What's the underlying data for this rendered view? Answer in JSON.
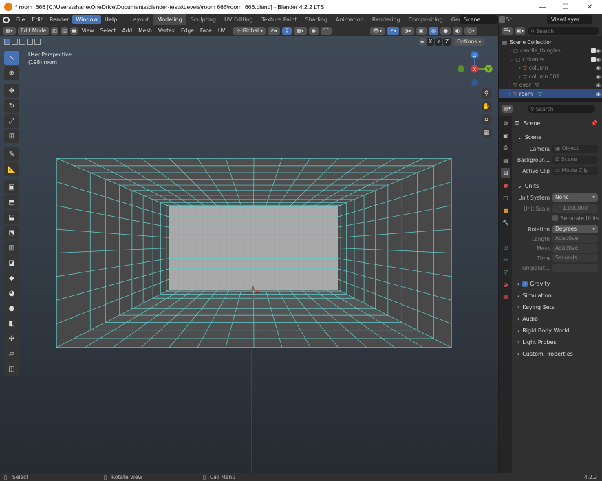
{
  "window": {
    "title": "* room_666 [C:\\Users\\shane\\OneDrive\\Documents\\blender-tests\\Levels\\room 666\\room_666.blend] - Blender 4.2.2 LTS",
    "minimize": "—",
    "maximize": "☐",
    "close": "✕"
  },
  "menubar": {
    "items": [
      "File",
      "Edit",
      "Render",
      "Window",
      "Help"
    ],
    "active": "Window"
  },
  "workspaces": [
    "Layout",
    "Modeling",
    "Sculpting",
    "UV Editing",
    "Texture Paint",
    "Shading",
    "Animation",
    "Rendering",
    "Compositing",
    "Geometry Nodes",
    "Sc"
  ],
  "active_workspace": "Modeling",
  "scene_field": "Scene",
  "viewlayer_field": "ViewLayer",
  "viewport_header": {
    "mode": "Edit Mode",
    "menus": [
      "View",
      "Select",
      "Add",
      "Mesh",
      "Vertex",
      "Edge",
      "Face",
      "UV"
    ],
    "transform_orientation": "Global",
    "axes": [
      "X",
      "Y",
      "Z"
    ],
    "options": "Options"
  },
  "viewport": {
    "perspective": "User Perspective",
    "object_info": "(198) room",
    "gizmo_axes": {
      "x": "X",
      "y": "Y",
      "z": "Z"
    }
  },
  "outliner": {
    "search_placeholder": "Search",
    "root": "Scene Collection",
    "rows": [
      {
        "name": "candle_thingies",
        "dim": true
      },
      {
        "name": "columns",
        "dim": true
      },
      {
        "name": "column",
        "dim": true
      },
      {
        "name": "column.001",
        "dim": true
      },
      {
        "name": "door",
        "dim": true
      },
      {
        "name": "room",
        "dim": false
      }
    ]
  },
  "properties": {
    "search_placeholder": "Search",
    "context": "Scene",
    "scene_panel": {
      "title": "Scene",
      "camera_label": "Camera",
      "camera_value": "Object",
      "background_label": "Backgroun...",
      "background_value": "Scene",
      "active_clip_label": "Active Clip",
      "active_clip_value": "Movie Clip"
    },
    "units_panel": {
      "title": "Units",
      "unit_system_label": "Unit System",
      "unit_system_value": "None",
      "unit_scale_label": "Unit Scale",
      "unit_scale_value": "1.000000",
      "separate_units": "Separate Units",
      "rotation_label": "Rotation",
      "rotation_value": "Degrees",
      "length_label": "Length",
      "length_value": "Adaptive",
      "mass_label": "Mass",
      "mass_value": "Adaptive",
      "time_label": "Time",
      "time_value": "Seconds",
      "temperature_label": "Temperat..."
    },
    "collapsed_panels": [
      "Gravity",
      "Simulation",
      "Keying Sets",
      "Audio",
      "Rigid Body World",
      "Light Probes",
      "Custom Properties"
    ]
  },
  "statusbar": {
    "select": "Select",
    "rotate": "Rotate View",
    "call_menu": "Call Menu",
    "version": "4.2.2"
  }
}
